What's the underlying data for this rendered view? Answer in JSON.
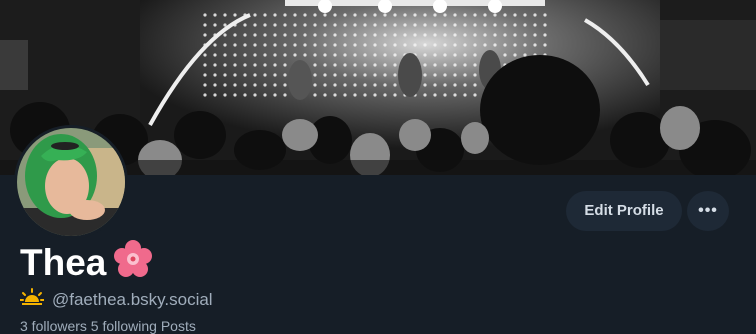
{
  "banner": {
    "description_name": "concert-banner"
  },
  "profile": {
    "display_name": "Thea",
    "name_emoji": "cherry-blossom-icon",
    "handle_emoji": "sunrise-icon",
    "handle": "@faethea.bsky.social",
    "stats_partial": "3 followers  5 following  Posts"
  },
  "actions": {
    "edit_label": "Edit Profile",
    "more_label": "•••"
  },
  "colors": {
    "background": "#161e27",
    "button_bg": "#1e2936",
    "name": "#ffffff",
    "handle": "#a0adbb"
  }
}
